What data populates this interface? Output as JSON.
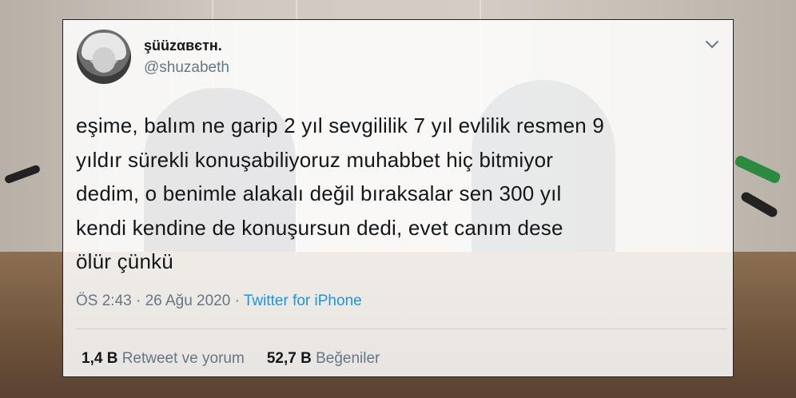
{
  "tweet": {
    "display_name": "şüüzαвєтн.",
    "handle": "@shuzabeth",
    "lines": [
      "eşime, balım ne garip 2 yıl sevgililik 7 yıl evlilik resmen 9",
      "yıldır sürekli konuşabiliyoruz muhabbet hiç bitmiyor",
      "dedim, o benimle alakalı değil bıraksalar sen 300 yıl",
      "kendi kendine de konuşursun dedi, evet canım dese",
      "ölür çünkü"
    ],
    "time": "ÖS 2:43 · 26 Ağu 2020 · ",
    "source": "Twitter for iPhone",
    "retweets_count": "1,4 B",
    "retweets_label": " Retweet ve yorum",
    "likes_count": "52,7 B",
    "likes_label": " Beğeniler"
  },
  "icons": {
    "caret": "chevron-down-icon",
    "avatar": "profile-photo"
  },
  "colors": {
    "text": "#14171a",
    "secondary": "#657786",
    "link": "#1b95e0"
  }
}
